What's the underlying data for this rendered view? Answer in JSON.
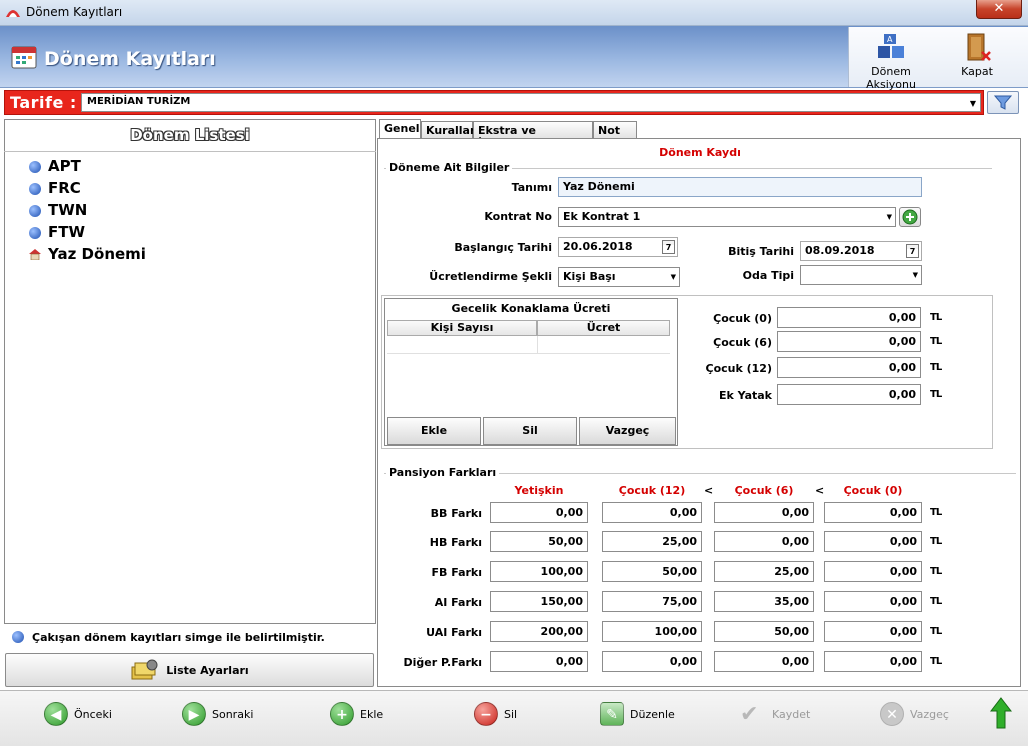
{
  "window": {
    "title": "Dönem Kayıtları",
    "close": "✕"
  },
  "header": {
    "title": "Dönem Kayıtları",
    "actions": [
      {
        "label": "Dönem Aksiyonu",
        "icon": "abc-blocks-icon"
      },
      {
        "label": "Kapat",
        "icon": "door-exit-icon"
      }
    ]
  },
  "tarife": {
    "label": "Tarife :",
    "value": "MERİDİAN TURİZM"
  },
  "left": {
    "title": "Dönem Listesi",
    "items": [
      {
        "label": "APT",
        "icon": "info-icon"
      },
      {
        "label": "FRC",
        "icon": "info-icon"
      },
      {
        "label": "TWN",
        "icon": "info-icon"
      },
      {
        "label": "FTW",
        "icon": "info-icon"
      },
      {
        "label": "Yaz Dönemi",
        "icon": "house-icon"
      }
    ],
    "info": "Çakışan dönem kayıtları simge ile belirtilmiştir.",
    "settings_button": "Liste Ayarları"
  },
  "tabs": [
    "Genel",
    "Kurallar",
    "Ekstra ve İndirimler",
    "Not"
  ],
  "form": {
    "section_title": "Dönem Kaydı",
    "group1": "Döneme Ait Bilgiler",
    "tanim_label": "Tanımı",
    "tanim_value": "Yaz Dönemi",
    "kontrat_label": "Kontrat No",
    "kontrat_value": "Ek Kontrat 1",
    "baslangic_label": "Başlangıç Tarihi",
    "baslangic_value": "20.06.2018",
    "bitis_label": "Bitiş Tarihi",
    "bitis_value": "08.09.2018",
    "ucret_label": "Ücretlendirme Şekli",
    "ucret_value": "Kişi Başı",
    "oda_label": "Oda Tipi",
    "oda_value": "",
    "cal_day": "7"
  },
  "gecelik": {
    "title": "Gecelik Konaklama Ücreti",
    "columns": [
      "Kişi Sayısı",
      "Ücret"
    ],
    "buttons": [
      "Ekle",
      "Sil",
      "Vazgeç"
    ]
  },
  "children": [
    {
      "label": "Çocuk (0)",
      "value": "0,00"
    },
    {
      "label": "Çocuk (6)",
      "value": "0,00"
    },
    {
      "label": "Çocuk (12)",
      "value": "0,00"
    },
    {
      "label": "Ek Yatak",
      "value": "0,00"
    }
  ],
  "currency": "TL",
  "pansiyon": {
    "title": "Pansiyon Farkları",
    "columns": [
      "Yetişkin",
      "Çocuk (12)",
      "Çocuk (6)",
      "Çocuk (0)"
    ],
    "separator": "<",
    "rows": [
      {
        "label": "BB Farkı",
        "values": [
          "0,00",
          "0,00",
          "0,00",
          "0,00"
        ]
      },
      {
        "label": "HB Farkı",
        "values": [
          "50,00",
          "25,00",
          "0,00",
          "0,00"
        ]
      },
      {
        "label": "FB Farkı",
        "values": [
          "100,00",
          "50,00",
          "25,00",
          "0,00"
        ]
      },
      {
        "label": "AI Farkı",
        "values": [
          "150,00",
          "75,00",
          "35,00",
          "0,00"
        ]
      },
      {
        "label": "UAI Farkı",
        "values": [
          "200,00",
          "100,00",
          "50,00",
          "0,00"
        ]
      },
      {
        "label": "Diğer P.Farkı",
        "values": [
          "0,00",
          "0,00",
          "0,00",
          "0,00"
        ]
      }
    ]
  },
  "toolbar": [
    {
      "label": "Önceki",
      "icon": "arrow-left-icon",
      "color": "#3aa335",
      "enabled": true
    },
    {
      "label": "Sonraki",
      "icon": "arrow-right-icon",
      "color": "#3aa335",
      "enabled": true
    },
    {
      "label": "Ekle",
      "icon": "plus-icon",
      "color": "#3aa335",
      "enabled": true
    },
    {
      "label": "Sil",
      "icon": "minus-icon",
      "color": "#d0251b",
      "enabled": true
    },
    {
      "label": "Düzenle",
      "icon": "edit-icon",
      "color": "#3aa335",
      "enabled": true
    },
    {
      "label": "Kaydet",
      "icon": "check-icon",
      "color": "#b0b0b0",
      "enabled": false
    },
    {
      "label": "Vazgeç",
      "icon": "cancel-icon",
      "color": "#b0b0b0",
      "enabled": false
    }
  ]
}
